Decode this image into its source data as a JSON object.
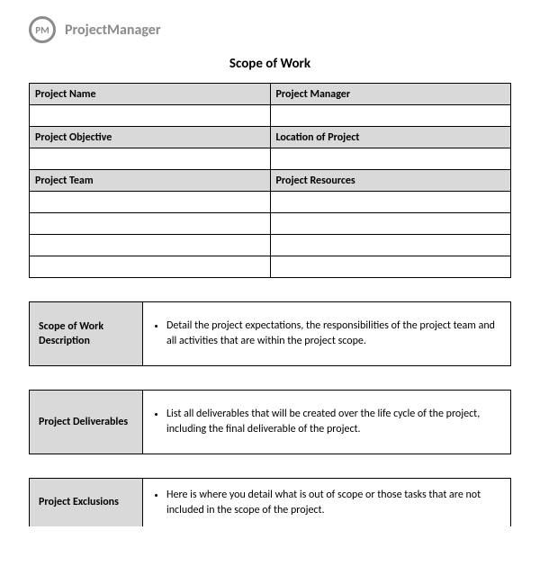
{
  "brand": {
    "icon_text": "PM",
    "name": "ProjectManager"
  },
  "title": "Scope of Work",
  "info_table": {
    "row1": {
      "left_label": "Project Name",
      "right_label": "Project Manager",
      "left_value": "",
      "right_value": ""
    },
    "row2": {
      "left_label": "Project Objective",
      "right_label": "Location of Project",
      "left_value": "",
      "right_value": ""
    },
    "row3": {
      "left_label": "Project Team",
      "right_label": "Project Resources"
    },
    "team_rows": [
      "",
      "",
      "",
      ""
    ],
    "resource_rows": [
      "",
      "",
      "",
      ""
    ]
  },
  "sections": {
    "sow_desc": {
      "label": "Scope of Work Description",
      "text": "Detail the project expectations, the responsibilities of the project team and all activities that are within the project scope."
    },
    "deliverables": {
      "label": "Project Deliverables",
      "text": "List all deliverables that will be created over the life cycle of the project, including the final deliverable of the project."
    },
    "exclusions": {
      "label": "Project Exclusions",
      "text": "Here is where you detail what is out of scope or those tasks that are not included in the scope of the project."
    }
  }
}
